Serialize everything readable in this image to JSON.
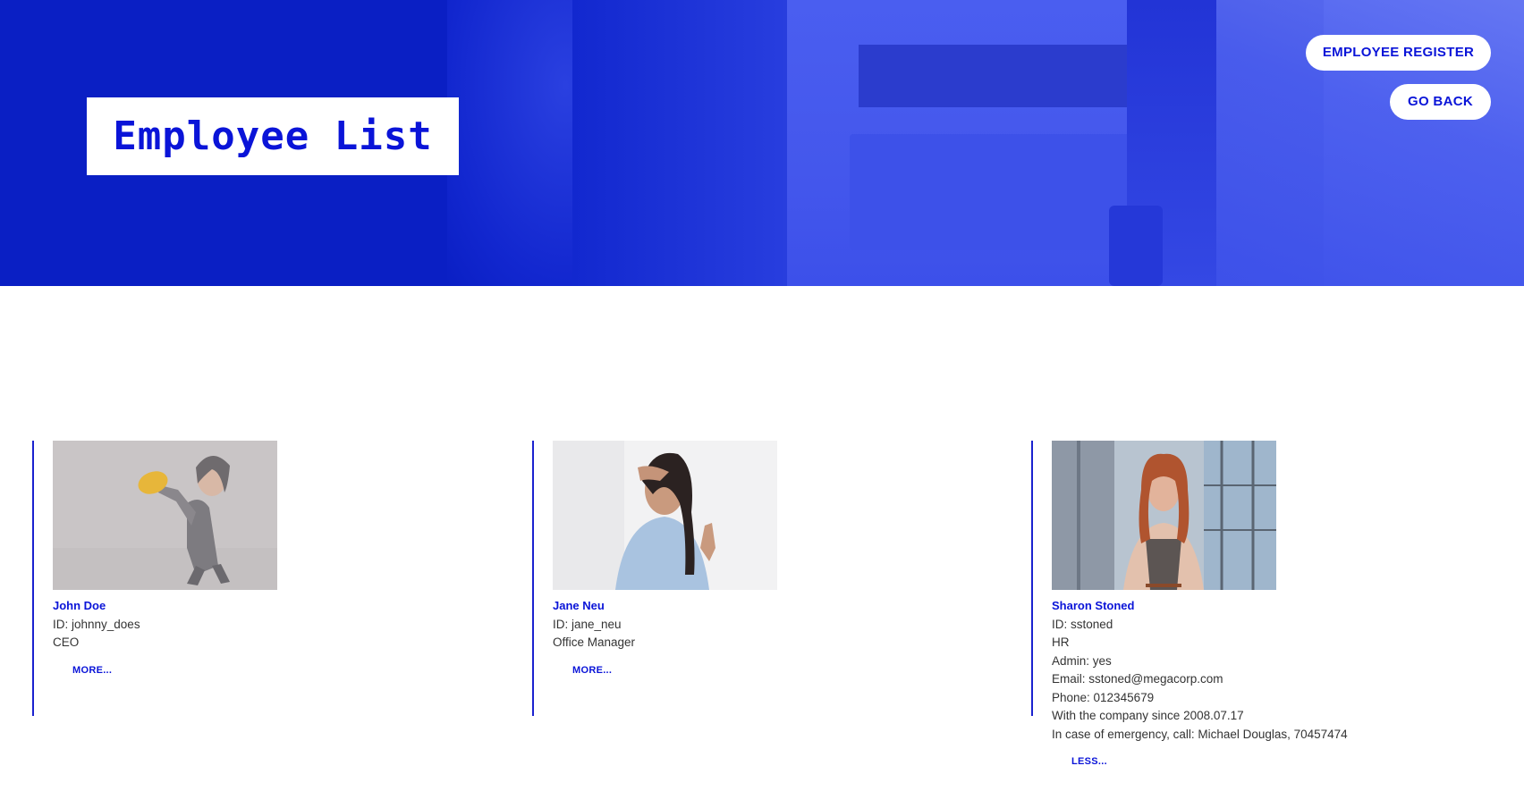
{
  "header": {
    "title": "Employee List",
    "register_label": "EMPLOYEE REGISTER",
    "back_label": "GO BACK"
  },
  "colors": {
    "accent": "#0a14d8",
    "hero": "#0a1fc4"
  },
  "employees": [
    {
      "name": "John Doe",
      "id_line": "ID: johnny_does",
      "role": "CEO",
      "toggle_label": "MORE..."
    },
    {
      "name": "Jane Neu",
      "id_line": "ID: jane_neu",
      "role": "Office Manager",
      "toggle_label": "MORE..."
    },
    {
      "name": "Sharon Stoned",
      "id_line": "ID: sstoned",
      "role": "HR",
      "admin": "Admin: yes",
      "email": "Email: sstoned@megacorp.com",
      "phone": "Phone: 012345679",
      "since": "With the company since 2008.07.17",
      "emergency": "In case of emergency, call: Michael Douglas, 70457474",
      "toggle_label": "LESS..."
    }
  ]
}
